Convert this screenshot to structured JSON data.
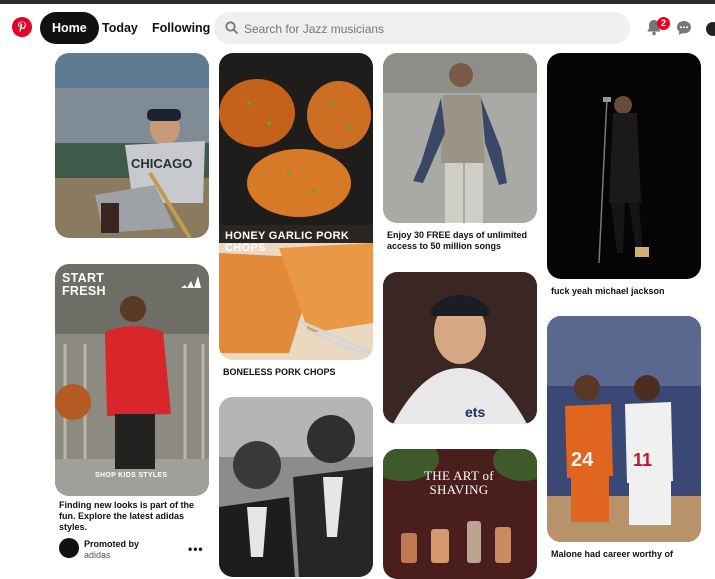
{
  "header": {
    "nav": [
      "Home",
      "Today",
      "Following"
    ],
    "search_placeholder": "Search for Jazz musicians",
    "notifications_count": "2",
    "icons": [
      "pinterest-logo-icon",
      "search-icon",
      "bell-icon",
      "chat-icon",
      "avatar"
    ]
  },
  "colors": {
    "brand": "#e60023",
    "active_nav": "#111111"
  },
  "pins": {
    "pork_chops_title": "HONEY GARLIC PORK CHOPS",
    "pork_chops_caption": "BONELESS PORK CHOPS",
    "spotify_caption": "Enjoy 30 FREE days of unlimited access to 50 million songs",
    "mj_caption": "fuck yeah michael jackson",
    "adidas_title": "START FRESH",
    "adidas_sub": "SHOP KIDS STYLES",
    "adidas_caption": "Finding new looks is part of the fun. Explore the latest adidas styles.",
    "promoted_by": "Promoted by",
    "promoted_name": "adidas",
    "art_of_shaving_title": "THE ART of SHAVING",
    "malone_caption": "Malone had career worthy of"
  }
}
